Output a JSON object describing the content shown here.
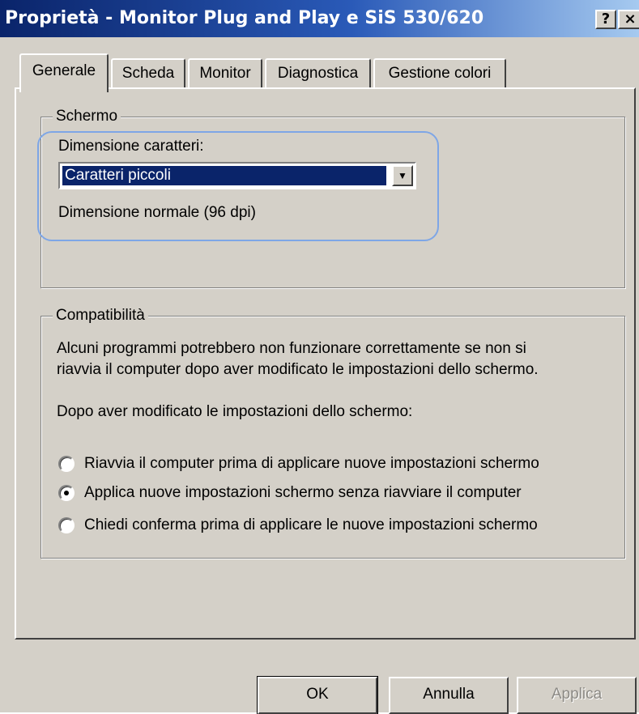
{
  "window": {
    "title": "Proprietà - Monitor Plug and Play e SiS 530/620",
    "help_label": "?",
    "close_label": "×"
  },
  "tabs": [
    {
      "label": "Generale",
      "active": true
    },
    {
      "label": "Scheda",
      "active": false
    },
    {
      "label": "Monitor",
      "active": false
    },
    {
      "label": "Diagnostica",
      "active": false
    },
    {
      "label": "Gestione colori",
      "active": false
    }
  ],
  "schermo": {
    "group_label": "Schermo",
    "font_size_label": "Dimensione caratteri:",
    "font_size_selected": "Caratteri piccoli",
    "font_size_description": "Dimensione normale (96 dpi)"
  },
  "compatibilita": {
    "group_label": "Compatibilità",
    "description_line1": "Alcuni programmi potrebbero non funzionare correttamente se non si",
    "description_line2": "riavvia il computer dopo aver modificato le impostazioni dello schermo.",
    "prompt": "Dopo aver modificato le impostazioni dello schermo:",
    "options": [
      {
        "label": "Riavvia il computer prima di applicare nuove impostazioni schermo",
        "selected": false
      },
      {
        "label": "Applica nuove impostazioni schermo senza riavviare il computer",
        "selected": true
      },
      {
        "label": "Chiedi conferma prima di applicare le nuove impostazioni schermo",
        "selected": false
      }
    ]
  },
  "buttons": {
    "ok": "OK",
    "cancel": "Annulla",
    "apply": "Applica"
  },
  "colors": {
    "title_gradient_start": "#0a246a",
    "title_gradient_end": "#a6caf0",
    "dialog_face": "#d4d0c8",
    "selection": "#0a246a",
    "highlight_outline": "#7ea6e6"
  }
}
